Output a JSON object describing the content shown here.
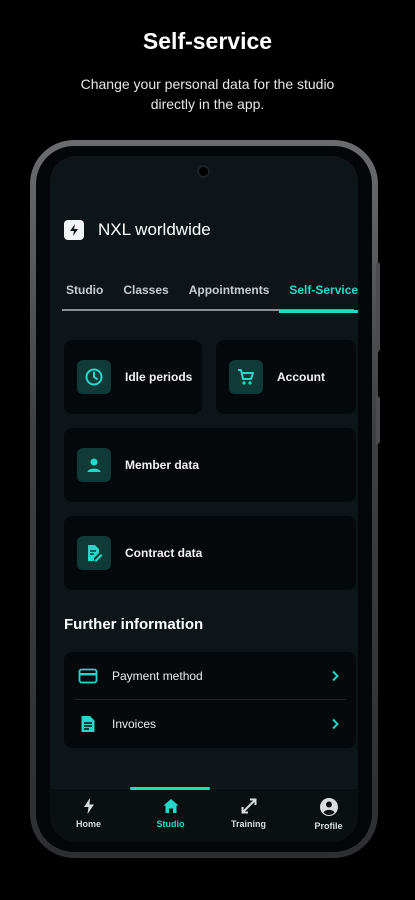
{
  "promo": {
    "title": "Self-service",
    "subtitle": "Change your personal data for the studio directly in the app."
  },
  "app": {
    "name": "NXL worldwide",
    "logo_icon": "bolt-logo"
  },
  "tabs": [
    {
      "label": "Studio",
      "active": false
    },
    {
      "label": "Classes",
      "active": false
    },
    {
      "label": "Appointments",
      "active": false
    },
    {
      "label": "Self-Service",
      "active": true
    }
  ],
  "cards": {
    "idle_periods": {
      "label": "Idle periods",
      "icon": "clock-icon"
    },
    "account": {
      "label": "Account",
      "icon": "cart-icon"
    },
    "member_data": {
      "label": "Member data",
      "icon": "person-icon"
    },
    "contract_data": {
      "label": "Contract data",
      "icon": "document-edit-icon"
    }
  },
  "further": {
    "title": "Further information",
    "items": [
      {
        "label": "Payment method",
        "icon": "credit-card-icon"
      },
      {
        "label": "Invoices",
        "icon": "document-icon"
      }
    ]
  },
  "bottom_nav": [
    {
      "label": "Home",
      "icon": "bolt-icon",
      "active": false
    },
    {
      "label": "Studio",
      "icon": "house-icon",
      "active": true
    },
    {
      "label": "Training",
      "icon": "arrows-expand-icon",
      "active": false
    },
    {
      "label": "Profile",
      "icon": "account-circle-icon",
      "active": false
    }
  ],
  "colors": {
    "accent": "#25d7c8",
    "background": "#000000",
    "screen": "#0e1519",
    "card": "#05090b",
    "icon_box": "#0f3a38"
  }
}
